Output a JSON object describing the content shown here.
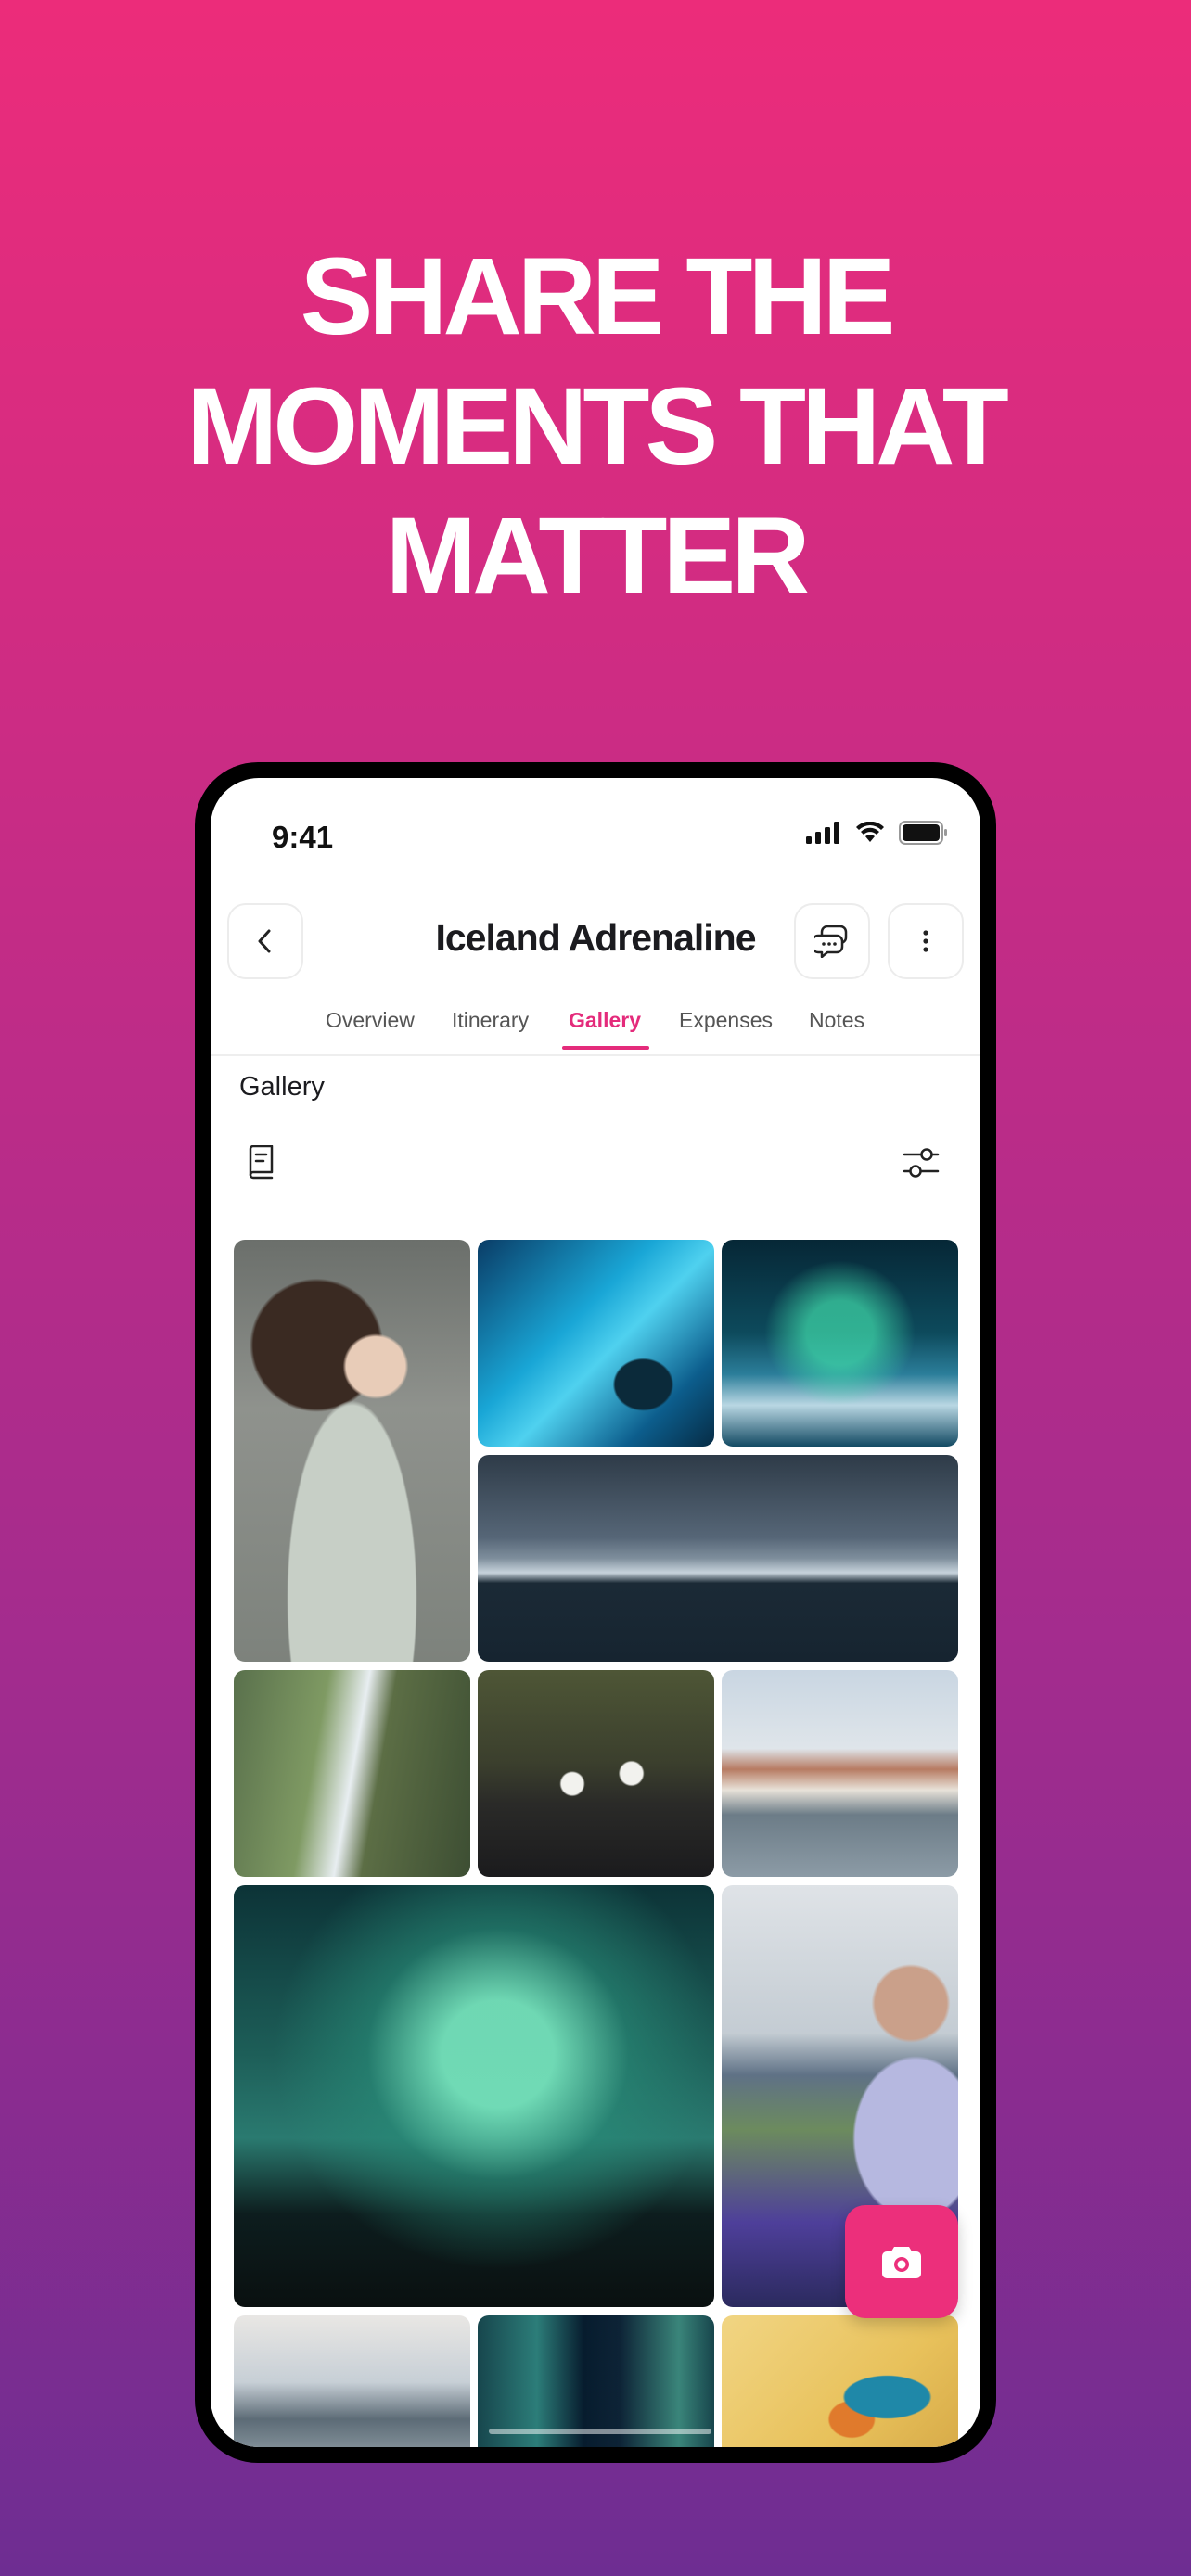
{
  "headline": {
    "line1": "SHARE THE",
    "line2": "MOMENTS THAT",
    "line3": "MATTER"
  },
  "status_bar": {
    "time": "9:41"
  },
  "header": {
    "title": "Iceland Adrenaline"
  },
  "tabs": [
    {
      "label": "Overview",
      "active": false
    },
    {
      "label": "Itinerary",
      "active": false
    },
    {
      "label": "Gallery",
      "active": true
    },
    {
      "label": "Expenses",
      "active": false
    },
    {
      "label": "Notes",
      "active": false
    }
  ],
  "gallery": {
    "section_title": "Gallery",
    "photos": [
      {
        "subject": "man with eyes closed in hoodie in misty forest"
      },
      {
        "subject": "blue ice cave with person silhouette"
      },
      {
        "subject": "aurora over glacier lagoon icebergs"
      },
      {
        "subject": "icebergs floating in dark lagoon under cloudy sky"
      },
      {
        "subject": "waterfall in green canyon"
      },
      {
        "subject": "puffins standing on rock"
      },
      {
        "subject": "colorful town by lake with swan and church"
      },
      {
        "subject": "green aurora borealis over dark landscape"
      },
      {
        "subject": "woman smiling in lupine field"
      },
      {
        "subject": "sea stacks on beach at dusk"
      },
      {
        "subject": "ice cave with night sky"
      },
      {
        "subject": "kingfisher bird on yellow background"
      }
    ]
  },
  "colors": {
    "accent": "#e42b7b",
    "fab": "#ec2f7b",
    "background_top": "#ec2c7a",
    "background_bottom": "#6e2d92"
  }
}
